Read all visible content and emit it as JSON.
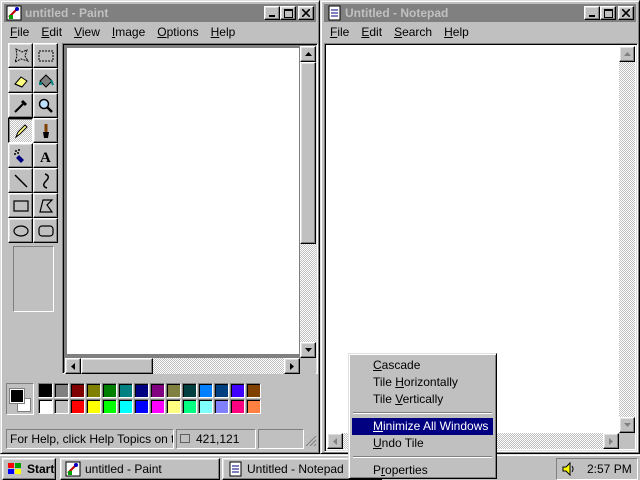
{
  "paint": {
    "title": "untitled - Paint",
    "menu": [
      "File",
      "Edit",
      "View",
      "Image",
      "Options",
      "Help"
    ],
    "menu_underline": [
      "F",
      "E",
      "V",
      "I",
      "O",
      "H"
    ],
    "status_help": "For Help, click Help Topics on the",
    "status_coords": "421,121",
    "tools": [
      "free-form-select",
      "select",
      "eraser",
      "fill-with-color",
      "pick-color",
      "magnifier",
      "pencil",
      "brush",
      "airbrush",
      "text",
      "line",
      "curve",
      "rectangle",
      "polygon",
      "ellipse",
      "rounded-rectangle"
    ],
    "selected_tool": "pencil",
    "foreground_color": "#000000",
    "background_color": "#ffffff",
    "palette_top": [
      "#000000",
      "#808080",
      "#800000",
      "#808000",
      "#008000",
      "#008080",
      "#000080",
      "#800080",
      "#808040",
      "#004040",
      "#0080ff",
      "#004080",
      "#4000ff",
      "#804000"
    ],
    "palette_bottom": [
      "#ffffff",
      "#c0c0c0",
      "#ff0000",
      "#ffff00",
      "#00ff00",
      "#00ffff",
      "#0000ff",
      "#ff00ff",
      "#ffff80",
      "#00ff80",
      "#80ffff",
      "#8080ff",
      "#ff0080",
      "#ff8040"
    ]
  },
  "notepad": {
    "title": "Untitled - Notepad",
    "menu": [
      "File",
      "Edit",
      "Search",
      "Help"
    ]
  },
  "context_menu": {
    "items": [
      "Cascade",
      "Tile Horizontally",
      "Tile Vertically",
      "Minimize All Windows",
      "Undo Tile",
      "Properties"
    ],
    "highlighted": "Minimize All Windows"
  },
  "taskbar": {
    "start_label": "Start",
    "tasks": [
      "untitled - Paint",
      "Untitled - Notepad"
    ],
    "clock": "2:57 PM"
  }
}
